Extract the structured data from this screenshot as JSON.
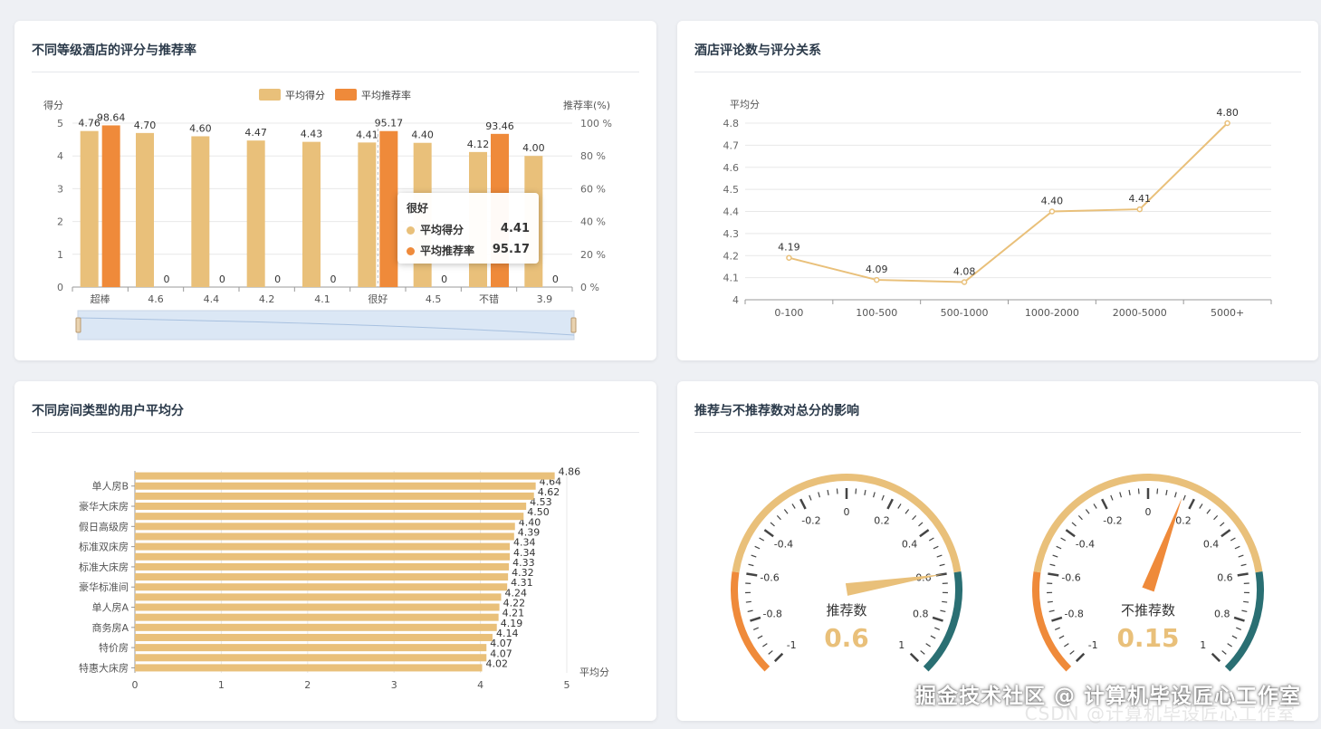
{
  "panels": {
    "p1_title": "不同等级酒店的评分与推荐率",
    "p2_title": "酒店评论数与评分关系",
    "p3_title": "不同房间类型的用户平均分",
    "p4_title": "推荐与不推荐数对总分的影响"
  },
  "tooltip": {
    "title": "很好",
    "rows": [
      {
        "label": "平均得分",
        "value": "4.41",
        "color": "#e9c07a"
      },
      {
        "label": "平均推荐率",
        "value": "95.17",
        "color": "#ef8a3a"
      }
    ]
  },
  "watermark": {
    "main": "掘金技术社区 @ 计算机毕设匠心工作室",
    "sub": "CSDN @计算机毕设匠心工作室"
  },
  "chart_data": [
    {
      "type": "bar",
      "title": "不同等级酒店的评分与推荐率",
      "categories": [
        "超棒",
        "4.6",
        "4.4",
        "4.2",
        "4.1",
        "很好",
        "4.5",
        "不错",
        "3.9"
      ],
      "series": [
        {
          "name": "平均得分",
          "values": [
            4.76,
            4.7,
            4.6,
            4.47,
            4.43,
            4.41,
            4.4,
            4.12,
            4.0
          ],
          "color": "#e9c07a",
          "labels": [
            "4.76",
            "4.70",
            "4.60",
            "4.47",
            "4.43",
            "4.41",
            "4.40",
            "4.12",
            "4.00"
          ]
        },
        {
          "name": "平均推荐率",
          "values": [
            98.64,
            0,
            0,
            0,
            0,
            95.17,
            0,
            93.46,
            0
          ],
          "color": "#ef8a3a",
          "labels": [
            "98.64",
            "0",
            "0",
            "0",
            "0",
            "95.17",
            "0",
            "93.46",
            "0"
          ]
        }
      ],
      "ylabel": "得分",
      "ylabel_right": "推荐率(%)",
      "ylim": [
        0,
        5
      ],
      "ylim_right": [
        0,
        100
      ],
      "yticks": [
        "0",
        "1",
        "2",
        "3",
        "4",
        "5"
      ],
      "yticks_right": [
        "0 %",
        "20 %",
        "40 %",
        "60 %",
        "80 %",
        "100 %"
      ],
      "legend": "top-center",
      "grid": true
    },
    {
      "type": "line",
      "title": "酒店评论数与评分关系",
      "categories": [
        "0-100",
        "100-500",
        "500-1000",
        "1000-2000",
        "2000-5000",
        "5000+"
      ],
      "series": [
        {
          "values": [
            4.19,
            4.09,
            4.08,
            4.4,
            4.41,
            4.8
          ],
          "color": "#e9c07a",
          "labels": [
            "4.19",
            "4.09",
            "4.08",
            "4.40",
            "4.41",
            "4.80"
          ]
        }
      ],
      "ylabel": "平均分",
      "ylim": [
        4,
        4.8
      ],
      "yticks": [
        "4",
        "4.1",
        "4.2",
        "4.3",
        "4.4",
        "4.5",
        "4.6",
        "4.7",
        "4.8"
      ],
      "grid": true
    },
    {
      "type": "bar",
      "orientation": "horizontal",
      "title": "不同房间类型的用户平均分",
      "categories": [
        "特惠大床房",
        "",
        "特价房",
        "",
        "商务房A",
        "",
        "单人房A",
        "",
        "豪华标准间",
        "",
        "标准大床房",
        "",
        "标准双床房",
        "",
        "假日高级房",
        "",
        "豪华大床房",
        "",
        "单人房B",
        ""
      ],
      "values": [
        4.02,
        4.07,
        4.07,
        4.14,
        4.19,
        4.21,
        4.22,
        4.24,
        4.31,
        4.32,
        4.33,
        4.34,
        4.34,
        4.39,
        4.4,
        4.5,
        4.53,
        4.62,
        4.64,
        4.86
      ],
      "labels": [
        "4.02",
        "4.07",
        "4.07",
        "4.14",
        "4.19",
        "4.21",
        "4.22",
        "4.24",
        "4.31",
        "4.32",
        "4.33",
        "4.34",
        "4.34",
        "4.39",
        "4.40",
        "4.50",
        "4.53",
        "4.62",
        "4.64",
        "4.86"
      ],
      "xlabel": "平均分",
      "xlim": [
        0,
        5
      ],
      "xticks": [
        "0",
        "1",
        "2",
        "3",
        "4",
        "5"
      ],
      "color": "#e9c07a",
      "grid": true
    },
    {
      "type": "gauge",
      "gauges": [
        {
          "name": "推荐数",
          "value": 0.6,
          "display": "0.6",
          "needle_color": "#e9c07a"
        },
        {
          "name": "不推荐数",
          "value": 0.15,
          "display": "0.15",
          "needle_color": "#ef8a3a"
        }
      ],
      "range": [
        -1,
        1
      ],
      "tick_labels": [
        "-1",
        "-0.8",
        "-0.6",
        "-0.4",
        "-0.2",
        "0",
        "0.2",
        "0.4",
        "0.6",
        "0.8",
        "1"
      ],
      "band_colors": [
        "#ef8a3a",
        "#e9c07a",
        "#2a6f73"
      ]
    }
  ]
}
